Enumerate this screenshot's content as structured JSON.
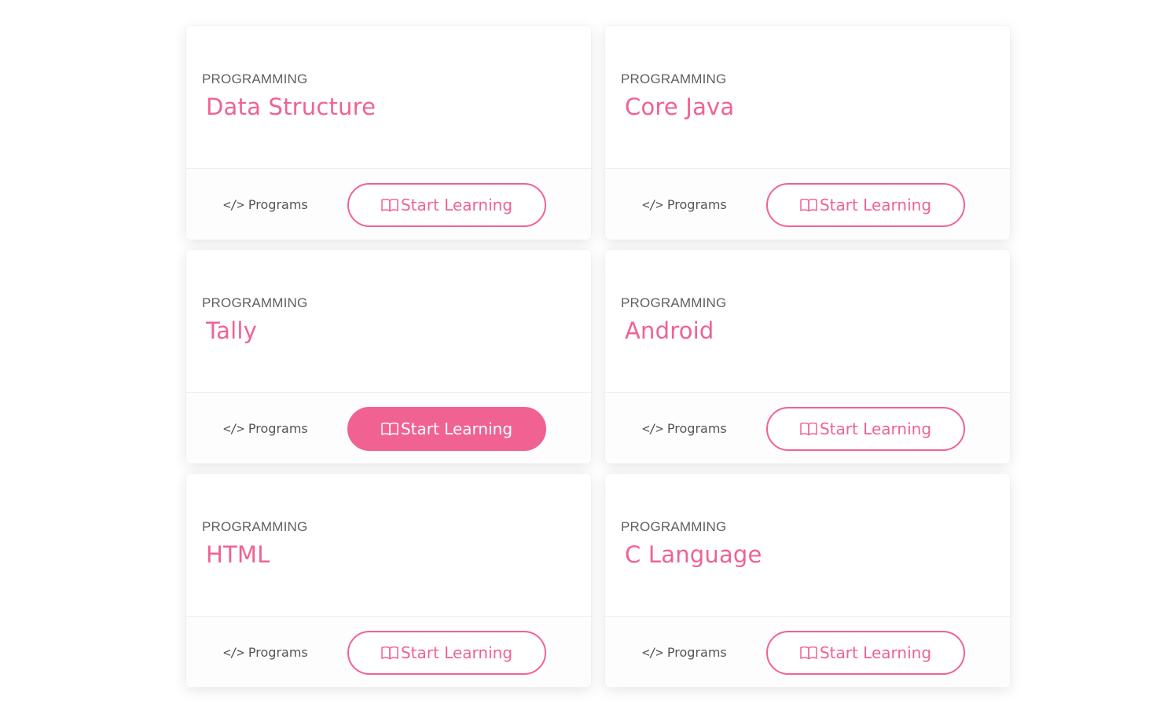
{
  "colors": {
    "accent": "#f06292",
    "category_text": "#5f5f5f",
    "meta_text": "#555555"
  },
  "cards": [
    {
      "category": "PROGRAMMING",
      "title": "Data Structure",
      "meta_icon": "code-icon",
      "meta_label": "Programs",
      "button_icon": "book-icon",
      "button_label": "Start Learning",
      "button_active": false
    },
    {
      "category": "PROGRAMMING",
      "title": "Core Java",
      "meta_icon": "code-icon",
      "meta_label": "Programs",
      "button_icon": "book-icon",
      "button_label": "Start Learning",
      "button_active": false
    },
    {
      "category": "PROGRAMMING",
      "title": "Tally",
      "meta_icon": "code-icon",
      "meta_label": "Programs",
      "button_icon": "book-icon",
      "button_label": "Start Learning",
      "button_active": true
    },
    {
      "category": "PROGRAMMING",
      "title": "Android",
      "meta_icon": "code-icon",
      "meta_label": "Programs",
      "button_icon": "book-icon",
      "button_label": "Start Learning",
      "button_active": false
    },
    {
      "category": "PROGRAMMING",
      "title": "HTML",
      "meta_icon": "code-icon",
      "meta_label": "Programs",
      "button_icon": "book-icon",
      "button_label": "Start Learning",
      "button_active": false
    },
    {
      "category": "PROGRAMMING",
      "title": "C Language",
      "meta_icon": "code-icon",
      "meta_label": "Programs",
      "button_icon": "book-icon",
      "button_label": "Start Learning",
      "button_active": false
    }
  ]
}
